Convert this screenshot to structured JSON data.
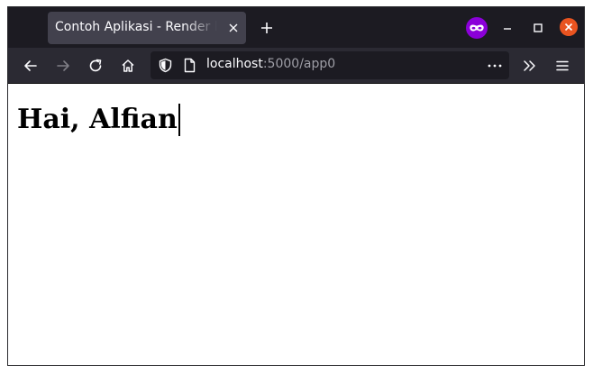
{
  "tab": {
    "title": "Contoh Aplikasi - Render ke View",
    "active": true
  },
  "toolbar": {
    "url_host": "localhost",
    "url_path": ":5000/app0"
  },
  "page": {
    "heading": "Hai, Alfian"
  },
  "icons": {
    "tab_close": "close-icon",
    "new_tab": "plus-icon",
    "profile": "private-mask-icon",
    "back": "arrow-left-icon",
    "forward": "arrow-right-icon",
    "reload": "reload-icon",
    "home": "home-icon",
    "shield": "shield-icon",
    "page": "page-icon",
    "page_actions": "ellipsis-icon",
    "overflow": "double-chevron-icon",
    "menu": "hamburger-icon"
  },
  "colors": {
    "tabbar_bg": "#1c1b22",
    "active_tab_bg": "#42414d",
    "toolbar_bg": "#2b2a33",
    "urlbar_bg": "#1c1b22",
    "profile_accent": "#8b00d9",
    "close_button": "#e95420"
  }
}
